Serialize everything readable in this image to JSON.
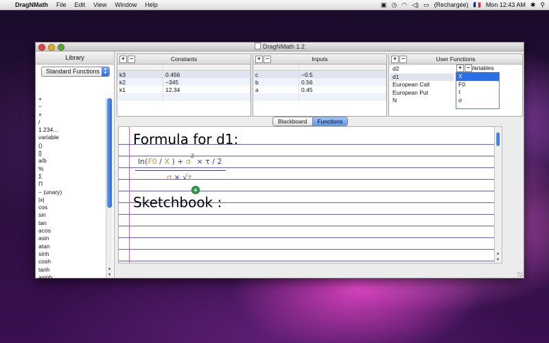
{
  "menubar": {
    "app_name": "DragNMath",
    "menus": [
      "File",
      "Edit",
      "View",
      "Window",
      "Help"
    ],
    "battery_status": "(Rechargée)",
    "clock": "Mon 12:43 AM",
    "flag": "🇫🇷"
  },
  "window": {
    "title": "DragNMath 1.2"
  },
  "library": {
    "header": "Library",
    "selected_set": "Standard Functions",
    "items": [
      "+",
      "−",
      "×",
      "/",
      "1.234...",
      "variable",
      "()",
      "[]",
      "a/b",
      "%",
      "Σ",
      "Π",
      "− (unary)",
      "|x|",
      "cos",
      "sin",
      "tan",
      "acos",
      "asin",
      "atan",
      "sinh",
      "cosh",
      "tanh",
      "asinh"
    ]
  },
  "constants": {
    "header": "Constants",
    "rows": [
      {
        "name": "k3",
        "value": "0.456"
      },
      {
        "name": "k2",
        "value": "−345"
      },
      {
        "name": "k1",
        "value": "12.34"
      }
    ]
  },
  "inputs": {
    "header": "Inputs",
    "rows": [
      {
        "name": "c",
        "value": "−0.5"
      },
      {
        "name": "b",
        "value": "0.56"
      },
      {
        "name": "a",
        "value": "0.45"
      }
    ]
  },
  "user_functions": {
    "header": "User Functions",
    "items": [
      "d2",
      "d1",
      "European Call",
      "European Put",
      "N"
    ],
    "selected": "d1",
    "variables_label": "Variables",
    "variables": [
      "X",
      "F0",
      "τ",
      "σ"
    ],
    "selected_variable": "X"
  },
  "tabs": {
    "items": [
      "Blackboard",
      "Functions"
    ],
    "active": "Functions"
  },
  "notebook": {
    "title": "Formula for d1:",
    "sketch_title": "Sketchbook :",
    "formula": {
      "ln_open": "ln(",
      "f0": "F0",
      "slash": " / ",
      "x": "X",
      "close_plus": " ) + ",
      "sigma": "σ",
      "exp": "2",
      "times_tau": " × τ",
      "div2": " / 2",
      "den_sigma": "σ",
      "den_times": " × √",
      "den_tau": "τ"
    }
  }
}
